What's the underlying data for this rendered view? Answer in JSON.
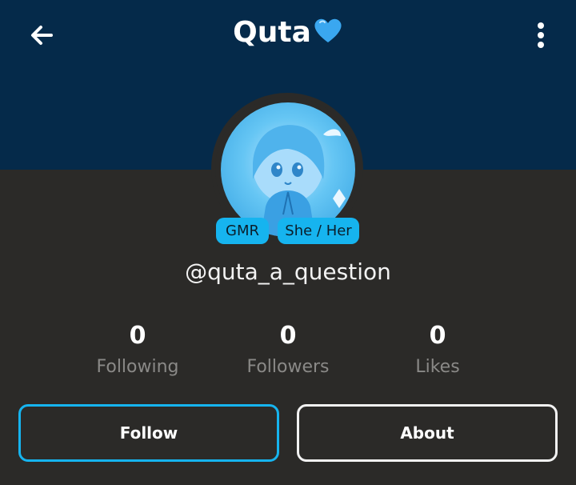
{
  "header": {
    "title": "Quta",
    "title_emoji_icon": "blue-heart-icon",
    "back_icon": "arrow-left-icon",
    "menu_icon": "vertical-dots-icon"
  },
  "profile": {
    "username": "@quta_a_question",
    "tags": [
      "GMR",
      "She / Her"
    ]
  },
  "stats": [
    {
      "value": "0",
      "label": "Following"
    },
    {
      "value": "0",
      "label": "Followers"
    },
    {
      "value": "0",
      "label": "Likes"
    }
  ],
  "actions": {
    "follow_label": "Follow",
    "about_label": "About"
  },
  "colors": {
    "banner": "#052a4a",
    "background": "#2b2a28",
    "accent": "#16b4ef",
    "muted_text": "#8a8987"
  }
}
